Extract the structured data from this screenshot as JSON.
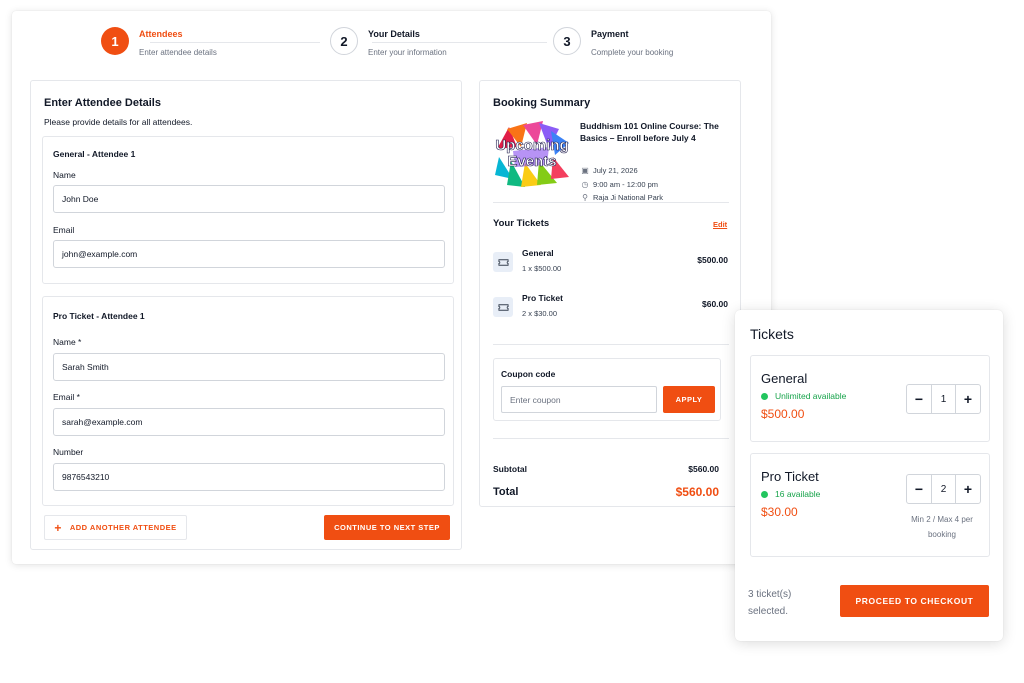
{
  "stepper": {
    "steps": [
      {
        "number": "1",
        "title": "Attendees",
        "subtitle": "Enter attendee details"
      },
      {
        "number": "2",
        "title": "Your Details",
        "subtitle": "Enter your information"
      },
      {
        "number": "3",
        "title": "Payment",
        "subtitle": "Complete your booking"
      }
    ]
  },
  "attendees": {
    "title": "Enter Attendee Details",
    "subtitle": "Please provide details for all attendees.",
    "groups": [
      {
        "title": "General - Attendee 1",
        "fields": [
          {
            "label": "Name",
            "value": "John Doe"
          },
          {
            "label": "Email",
            "value": "john@example.com"
          }
        ]
      },
      {
        "title": "Pro Ticket - Attendee 1",
        "fields": [
          {
            "label": "Name *",
            "value": "Sarah Smith"
          },
          {
            "label": "Email *",
            "value": "sarah@example.com"
          },
          {
            "label": "Number",
            "value": "9876543210"
          }
        ]
      }
    ],
    "add_label": "ADD ANOTHER ATTENDEE",
    "continue_label": "CONTINUE TO NEXT STEP"
  },
  "summary": {
    "title": "Booking Summary",
    "event": {
      "image_text": [
        "Upcoming",
        "Events"
      ],
      "name": "Buddhism 101 Online Course: The Basics – Enroll before July 4",
      "date": "July 21, 2026",
      "time": "9:00 am - 12:00 pm",
      "location": "Raja Ji National Park"
    },
    "tickets_heading": "Your Tickets",
    "edit_label": "Edit",
    "tickets": [
      {
        "name": "General",
        "qty": "1 x $500.00",
        "price": "$500.00"
      },
      {
        "name": "Pro Ticket",
        "qty": "2 x $30.00",
        "price": "$60.00"
      }
    ],
    "coupon": {
      "label": "Coupon code",
      "placeholder": "Enter coupon",
      "button": "APPLY"
    },
    "subtotal_label": "Subtotal",
    "subtotal": "$560.00",
    "total_label": "Total",
    "total": "$560.00"
  },
  "ticket_selector": {
    "title": "Tickets",
    "items": [
      {
        "name": "General",
        "availability": "Unlimited available",
        "price": "$500.00",
        "quantity": "1"
      },
      {
        "name": "Pro Ticket",
        "availability": "16 available",
        "price": "$30.00",
        "quantity": "2",
        "limit": "Min 2 / Max 4 per booking"
      }
    ],
    "selected_count": "3 ticket(s) selected.",
    "checkout_label": "PROCEED TO CHECKOUT"
  },
  "colors": {
    "accent": "#f04e12",
    "success": "#16a34a",
    "border": "#e5e7eb"
  }
}
